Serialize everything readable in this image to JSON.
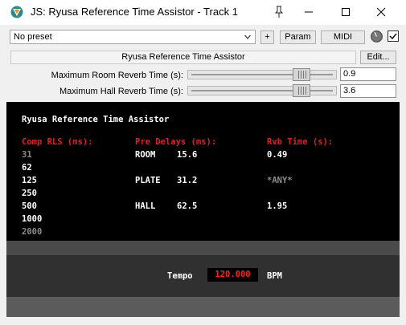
{
  "window": {
    "title": "JS: Ryusa Reference Time Assistor - Track 1"
  },
  "toolbar": {
    "preset": "No preset",
    "plus_label": "+",
    "param_label": "Param",
    "midi_label": "MIDI",
    "bypass_checked": true
  },
  "effect": {
    "name": "Ryusa Reference Time Assistor",
    "edit_label": "Edit..."
  },
  "sliders": [
    {
      "label": "Maximum Room Reverb Time (s):",
      "value": "0.9",
      "fill": 0.8
    },
    {
      "label": "Maximum Hall Reverb Time (s):",
      "value": "3.6",
      "fill": 0.8
    }
  ],
  "display": {
    "heading": "Ryusa Reference Time Assistor",
    "col_headers": [
      "Comp RLS (ms):",
      "Pre Delays (ms):",
      "Rvb Time (s):"
    ],
    "comp_values": [
      {
        "text": "31",
        "dim": true
      },
      {
        "text": "62",
        "dim": false
      },
      {
        "text": "125",
        "dim": false
      },
      {
        "text": "250",
        "dim": false
      },
      {
        "text": "500",
        "dim": false
      },
      {
        "text": "1000",
        "dim": false
      },
      {
        "text": "2000",
        "dim": true
      }
    ],
    "rows": [
      {
        "type": "ROOM",
        "delay": "15.6",
        "rvb": "0.49",
        "rvb_dim": false
      },
      {
        "type": "PLATE",
        "delay": "31.2",
        "rvb": "*ANY*",
        "rvb_dim": true
      },
      {
        "type": "HALL",
        "delay": "62.5",
        "rvb": "1.95",
        "rvb_dim": false
      }
    ],
    "tempo_label": "Tempo",
    "tempo_value": "120.000",
    "tempo_unit": "BPM"
  },
  "colors": {
    "header_red": "#e02020",
    "text_white": "#ffffff",
    "text_dim": "#8c8c8c",
    "tempo_red": "#ff2020"
  }
}
